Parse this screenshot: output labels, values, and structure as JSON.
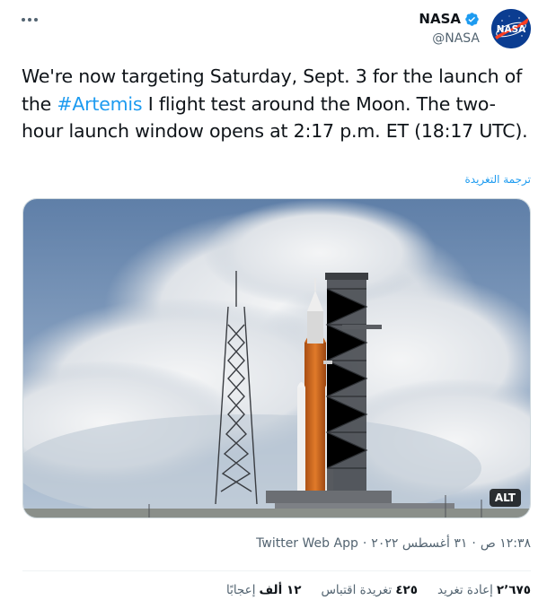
{
  "tweet": {
    "author": {
      "display_name": "NASA",
      "handle": "@NASA",
      "verified_icon": "verified-badge-icon",
      "avatar_icon": "nasa-meatball-logo",
      "avatar_text": "NASA"
    },
    "text": {
      "part1": "We're now targeting Saturday, Sept. 3 for the launch of the ",
      "hashtag": "#Artemis",
      "part2": " I flight test around the Moon. The two-hour launch window opens at 2:17 p.m. ET (18:17 UTC)."
    },
    "translate_label": "ترجمة التغريدة",
    "media": {
      "alt_badge": "ALT",
      "description_icon": "rocket-launchpad-photo"
    },
    "meta": {
      "time": "١٢:٣٨ ص",
      "separator": "·",
      "date": "٣١ أغسطس ٢٠٢٢",
      "source": "Twitter Web App"
    },
    "stats": {
      "retweets_count": "٢٬٦٧٥",
      "retweets_label": "إعادة تغريد",
      "quotes_count": "٤٢٥",
      "quotes_label": "تغريدة اقتباس",
      "likes_count": "١٢ ألف",
      "likes_label": "إعجابًا"
    },
    "colors": {
      "accent": "#1d9bf0",
      "text": "#0f1419",
      "secondary": "#536471",
      "nasa_blue": "#0b3d91",
      "nasa_red": "#fc3d21"
    }
  }
}
